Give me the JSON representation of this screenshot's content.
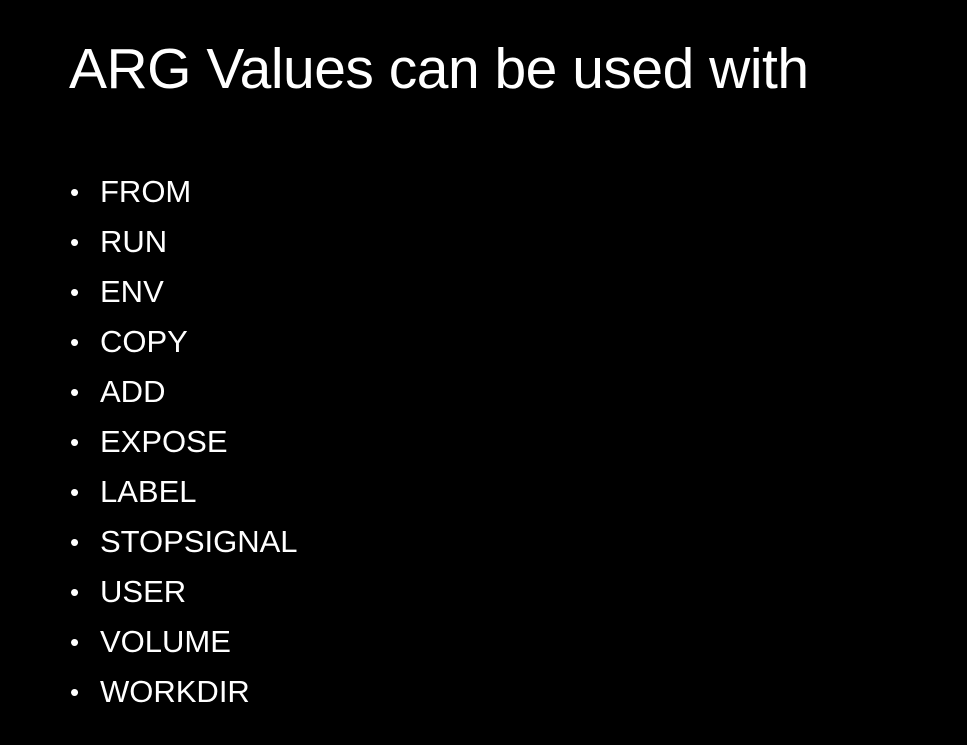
{
  "slide": {
    "title": "ARG Values can be used with",
    "bullet_glyph": "•",
    "items": [
      "FROM",
      "RUN",
      "ENV",
      "COPY",
      "ADD",
      "EXPOSE",
      "LABEL",
      "STOPSIGNAL",
      "USER",
      "VOLUME",
      "WORKDIR"
    ]
  },
  "colors": {
    "background": "#000000",
    "text": "#ffffff"
  }
}
